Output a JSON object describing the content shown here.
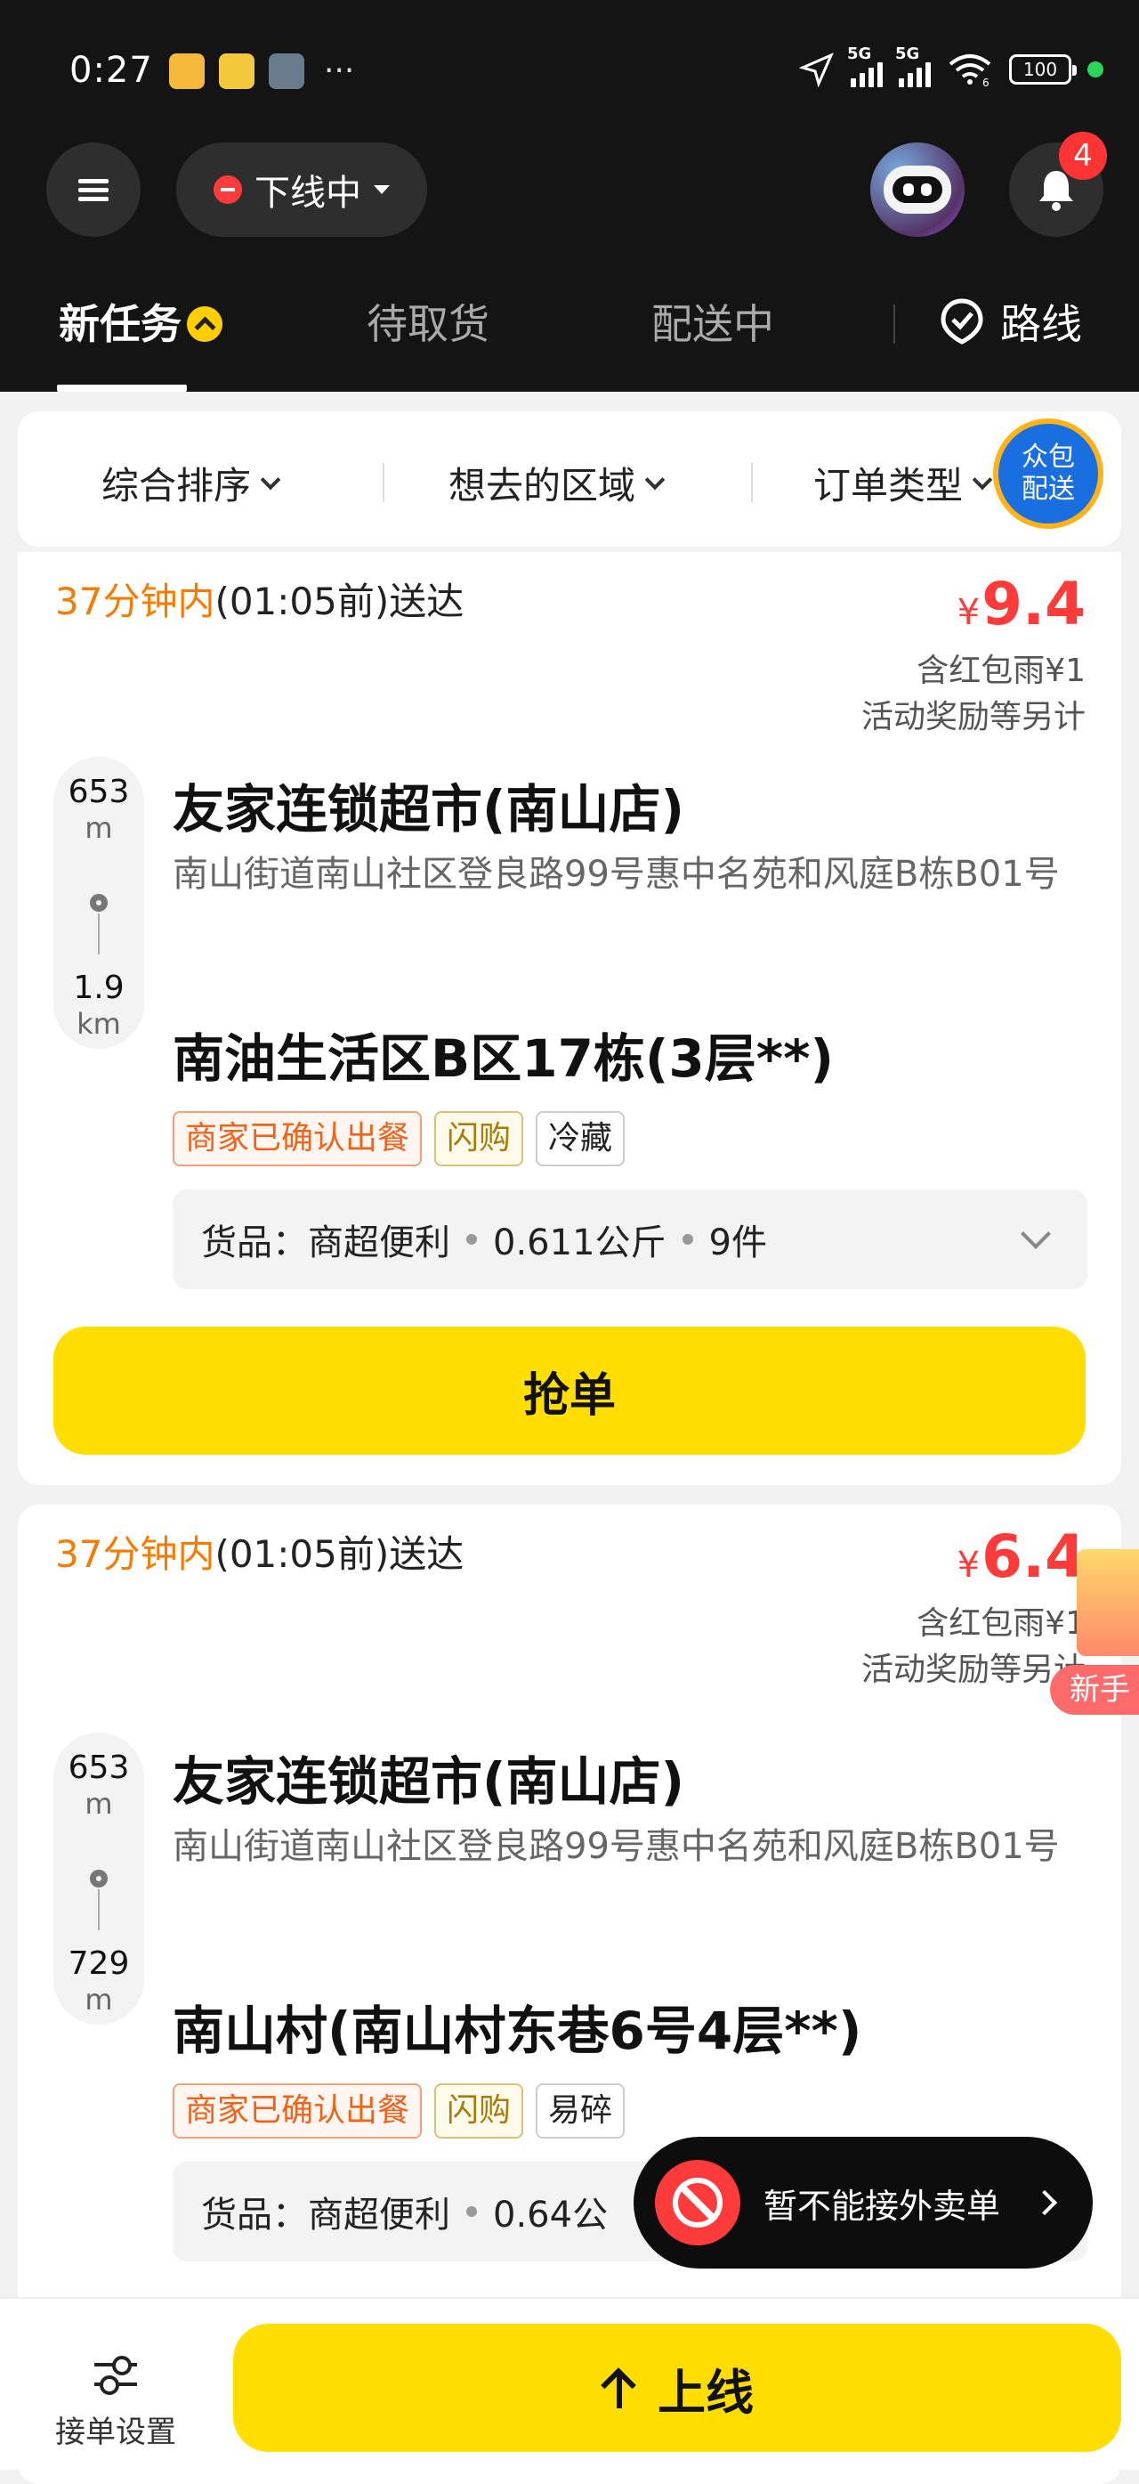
{
  "status_bar": {
    "time": "0:27",
    "more": "···",
    "net1": "5G",
    "net2": "5G",
    "wifi_sub": "6",
    "battery": "100"
  },
  "header": {
    "online_status": "下线中",
    "notif_count": "4"
  },
  "tabs": [
    {
      "label": "新任务"
    },
    {
      "label": "待取货"
    },
    {
      "label": "配送中"
    }
  ],
  "route_label": "路线",
  "filters": {
    "sort": "综合排序",
    "area": "想去的区域",
    "type": "订单类型"
  },
  "float_badge": {
    "line1": "众包",
    "line2": "配送"
  },
  "orders": [
    {
      "deadline_hl": "37分钟内",
      "deadline_rest": "(01:05前)送达",
      "currency": "¥",
      "price": "9.4",
      "note1": "含红包雨¥1",
      "note2": "活动奖励等另计",
      "dist1": "653",
      "dist1_unit": "m",
      "dist2": "1.9",
      "dist2_unit": "km",
      "shop": "友家连锁超市(南山店)",
      "address": "南山街道南山社区登良路99号惠中名苑和风庭B栋B01号",
      "destination": "南油生活区B区17栋(3层**)",
      "tags": [
        "商家已确认出餐",
        "闪购",
        "冷藏"
      ],
      "goods": {
        "cat": "货品：商超便利",
        "weight": "0.611公斤",
        "count": "9件"
      },
      "grab": "抢单"
    },
    {
      "deadline_hl": "37分钟内",
      "deadline_rest": "(01:05前)送达",
      "currency": "¥",
      "price": "6.4",
      "note1": "含红包雨¥1",
      "note2": "活动奖励等另计",
      "dist1": "653",
      "dist1_unit": "m",
      "dist2": "729",
      "dist2_unit": "m",
      "shop": "友家连锁超市(南山店)",
      "address": "南山街道南山社区登良路99号惠中名苑和风庭B栋B01号",
      "destination": "南山村(南山村东巷6号4层**)",
      "tags": [
        "商家已确认出餐",
        "闪购",
        "易碎"
      ],
      "goods": {
        "cat": "货品：商超便利",
        "weight": "0.64公"
      }
    }
  ],
  "newbie_label": "新手",
  "toast": "暂不能接外卖单",
  "bottom": {
    "settings": "接单设置",
    "online_button": "上线"
  },
  "colors": {
    "accent": "#ffde00",
    "price": "#ff3a3a",
    "deadline": "#f57c00",
    "dark": "#141414"
  }
}
